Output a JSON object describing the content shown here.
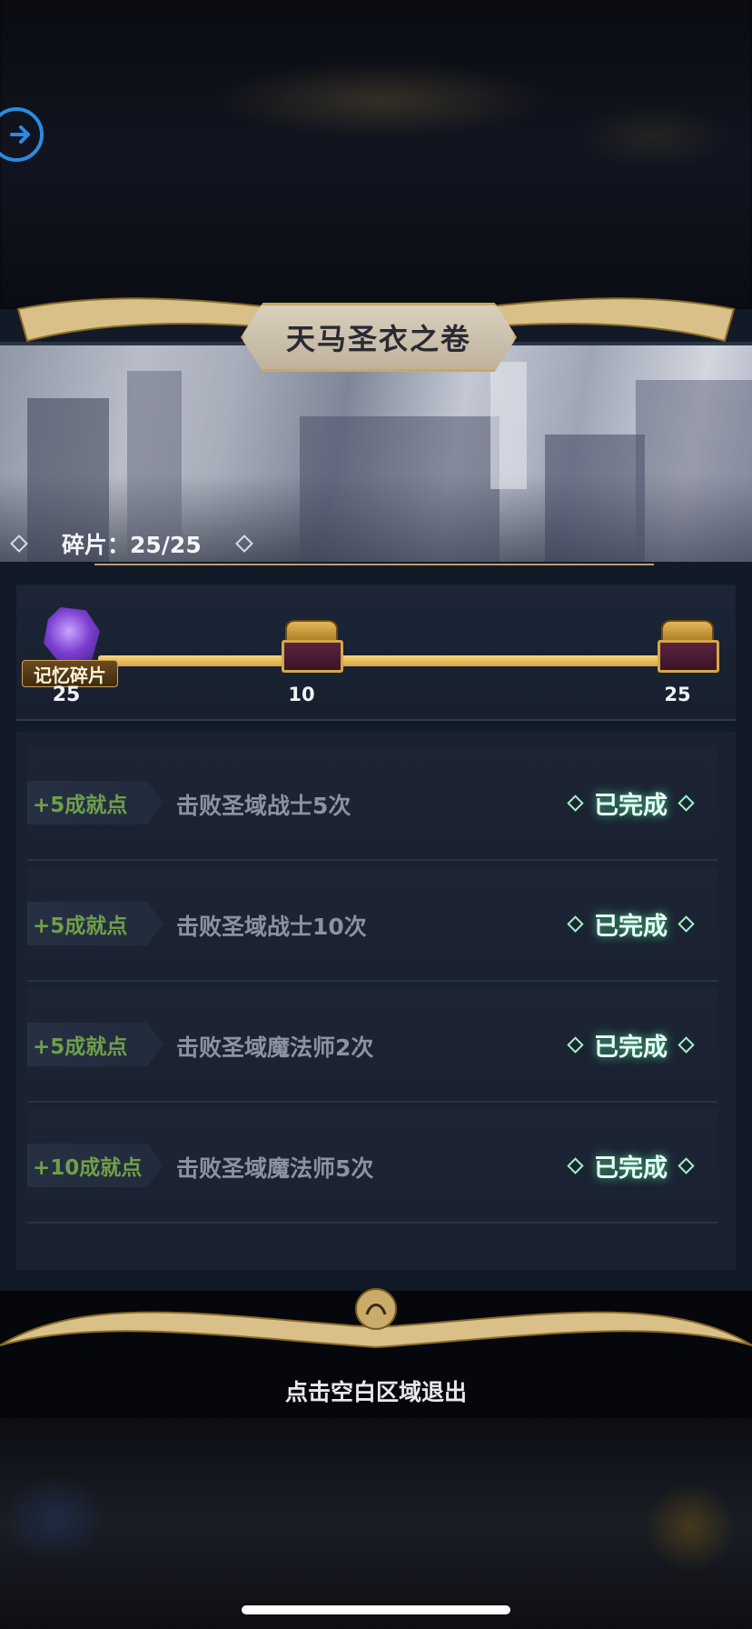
{
  "title": "天马圣衣之卷",
  "fragments_label": "碎片：25/25",
  "progress": {
    "item_name": "记忆碎片",
    "current_count": "25",
    "milestones": [
      {
        "count": "10"
      },
      {
        "count": "25"
      }
    ],
    "fill_fraction": 1.0
  },
  "tasks": [
    {
      "reward": "+5成就点",
      "desc": "击败圣域战士5次",
      "status": "已完成"
    },
    {
      "reward": "+5成就点",
      "desc": "击败圣域战士10次",
      "status": "已完成"
    },
    {
      "reward": "+5成就点",
      "desc": "击败圣域魔法师2次",
      "status": "已完成"
    },
    {
      "reward": "+10成就点",
      "desc": "击败圣域魔法师5次",
      "status": "已完成"
    }
  ],
  "exit_hint": "点击空白区域退出",
  "colors": {
    "accent_gold": "#c9a860",
    "reward_green": "#6ea04a",
    "complete_glow": "#50ffaa",
    "exit_button_blue": "#2b8be0"
  },
  "icons": {
    "exit": "arrow-right-circle-icon",
    "fragment": "purple-crystal-icon",
    "milestone": "treasure-chest-icon"
  }
}
